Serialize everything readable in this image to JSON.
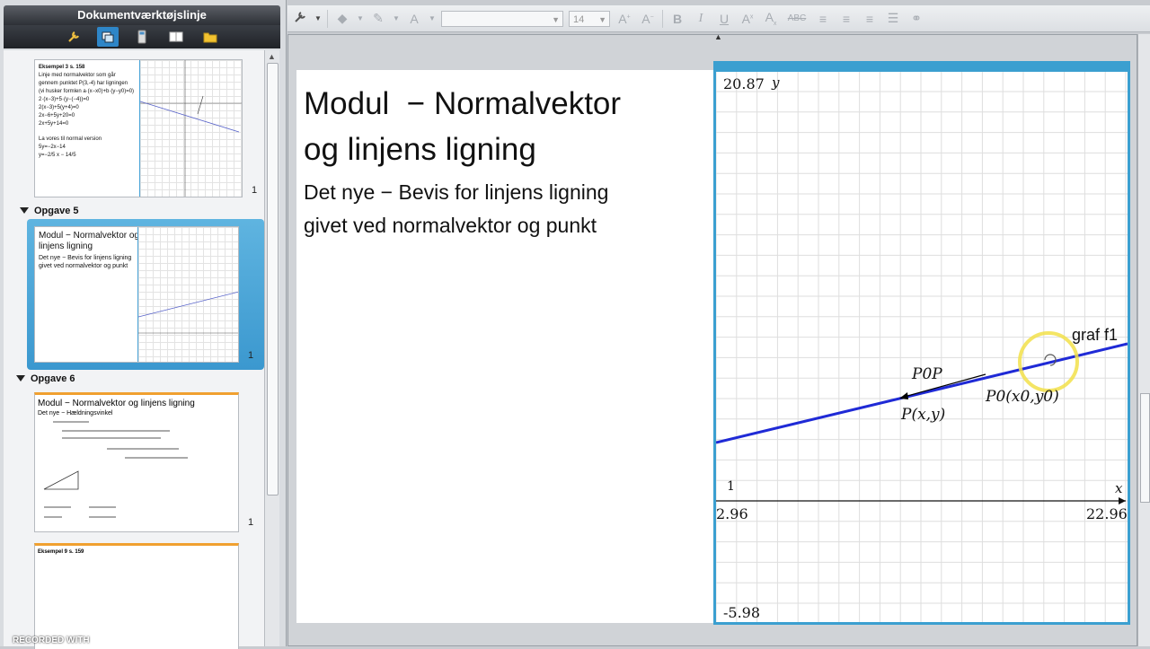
{
  "left_panel": {
    "title": "Dokumentværktøjslinje",
    "sections": [
      {
        "heading": "Opgave 5",
        "page_number": "1"
      },
      {
        "heading": "Opgave 6",
        "page_number": "1"
      }
    ],
    "first_page_number": "1",
    "thumb1": {
      "lines": [
        "Eksempel 3 s. 158",
        "Linje med normalvektor som går",
        "gennem punktet P(3,-4) har ligningen",
        "(vi husker formlen a·(x−x0)+b·(y−y0)=0)",
        "2·(x−3)+5·(y−(−4))=0",
        "2(x−3)+5(y+4)=0",
        "2x−6+5y+20=0",
        "2x+5y+14=0",
        "La vores til normal version",
        "5y=−2x−14",
        "y=−2/5 x − 14/5"
      ]
    },
    "thumb2": {
      "title": "Modul  − Normalvektor og linjens ligning",
      "body": "Det nye − Bevis for linjens ligning givet ved normalvektor og punkt"
    },
    "thumb3": {
      "title": "Modul − Normalvektor og linjens ligning",
      "body": "Det nye − Hældningsvinkel"
    },
    "thumb4": {
      "title": "Eksempel 9 s. 159"
    },
    "recorded": "RECORDED WITH"
  },
  "toolbar": {
    "font_size": "14"
  },
  "page": {
    "title_line1": "Modul  − Normalvektor",
    "title_line2": "og linjens ligning",
    "body_line1": "Det nye − Bevis for linjens ligning",
    "body_line2": "givet ved normalvektor og punkt"
  },
  "graph": {
    "y_max": "20.87",
    "y_min": "-5.98",
    "x_min": "2.96",
    "x_max": "22.96",
    "x_axis_label": "x",
    "y_axis_label": "y",
    "scale_label": "1",
    "function_label": "graf f1",
    "labels": {
      "p0p": "P0P",
      "p": "P(x,y)",
      "p0": "P0(x0,y0)"
    },
    "line_color": "#1f2ad6",
    "frame_color": "#3b9fd0"
  }
}
